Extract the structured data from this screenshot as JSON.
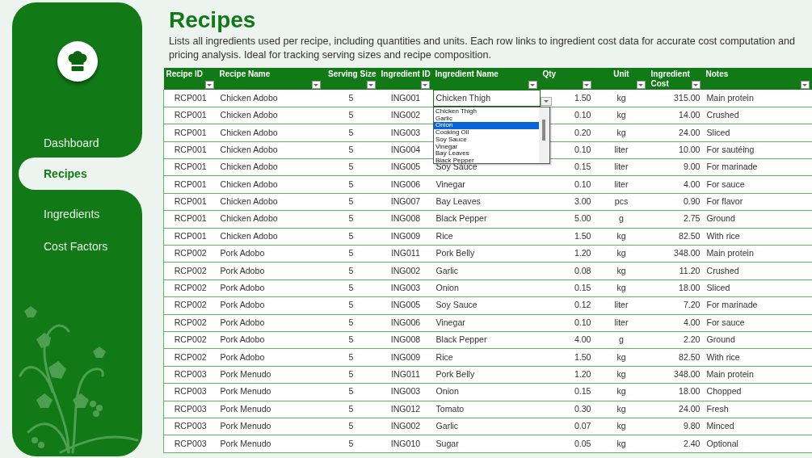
{
  "sidebar": {
    "items": [
      {
        "label": "Dashboard",
        "selected": false
      },
      {
        "label": "Recipes",
        "selected": true
      },
      {
        "label": "Ingredients",
        "selected": false
      },
      {
        "label": "Cost Factors",
        "selected": false
      }
    ]
  },
  "page": {
    "title": "Recipes",
    "description": "Lists all ingredients used per recipe, including quantities and units. Each row links to ingredient cost data for accurate cost computation and pricing analysis. Ideal for tracking serving sizes and recipe composition."
  },
  "table": {
    "columns": [
      {
        "label": "Recipe ID"
      },
      {
        "label": "Recipe Name"
      },
      {
        "label": "Serving Size"
      },
      {
        "label": "Ingredient ID"
      },
      {
        "label": "Ingredient Name"
      },
      {
        "label": "Qty"
      },
      {
        "label": "Unit"
      },
      {
        "label": "Ingredient Cost"
      },
      {
        "label": "Notes"
      }
    ],
    "rows": [
      [
        "RCP001",
        "Chicken Adobo",
        "5",
        "ING001",
        "Chicken Thigh",
        "1.50",
        "kg",
        "315.00",
        "Main protein"
      ],
      [
        "RCP001",
        "Chicken Adobo",
        "5",
        "ING002",
        "",
        "0.10",
        "kg",
        "14.00",
        "Crushed"
      ],
      [
        "RCP001",
        "Chicken Adobo",
        "5",
        "ING003",
        "",
        "0.20",
        "kg",
        "24.00",
        "Sliced"
      ],
      [
        "RCP001",
        "Chicken Adobo",
        "5",
        "ING004",
        "",
        "0.10",
        "liter",
        "10.00",
        "For sautéing"
      ],
      [
        "RCP001",
        "Chicken Adobo",
        "5",
        "ING005",
        "Soy Sauce",
        "0.15",
        "liter",
        "9.00",
        "For marinade"
      ],
      [
        "RCP001",
        "Chicken Adobo",
        "5",
        "ING006",
        "Vinegar",
        "0.10",
        "liter",
        "4.00",
        "For sauce"
      ],
      [
        "RCP001",
        "Chicken Adobo",
        "5",
        "ING007",
        "Bay Leaves",
        "3.00",
        "pcs",
        "0.90",
        "For flavor"
      ],
      [
        "RCP001",
        "Chicken Adobo",
        "5",
        "ING008",
        "Black Pepper",
        "5.00",
        "g",
        "2.75",
        "Ground"
      ],
      [
        "RCP001",
        "Chicken Adobo",
        "5",
        "ING009",
        "Rice",
        "1.50",
        "kg",
        "82.50",
        "With rice"
      ],
      [
        "RCP002",
        "Pork Adobo",
        "5",
        "ING011",
        "Pork Belly",
        "1.20",
        "kg",
        "348.00",
        "Main protein"
      ],
      [
        "RCP002",
        "Pork Adobo",
        "5",
        "ING002",
        "Garlic",
        "0.08",
        "kg",
        "11.20",
        "Crushed"
      ],
      [
        "RCP002",
        "Pork Adobo",
        "5",
        "ING003",
        "Onion",
        "0.15",
        "kg",
        "18.00",
        "Sliced"
      ],
      [
        "RCP002",
        "Pork Adobo",
        "5",
        "ING005",
        "Soy Sauce",
        "0.12",
        "liter",
        "7.20",
        "For marinade"
      ],
      [
        "RCP002",
        "Pork Adobo",
        "5",
        "ING006",
        "Vinegar",
        "0.10",
        "liter",
        "4.00",
        "For sauce"
      ],
      [
        "RCP002",
        "Pork Adobo",
        "5",
        "ING008",
        "Black Pepper",
        "4.00",
        "g",
        "2.20",
        "Ground"
      ],
      [
        "RCP002",
        "Pork Adobo",
        "5",
        "ING009",
        "Rice",
        "1.50",
        "kg",
        "82.50",
        "With rice"
      ],
      [
        "RCP003",
        "Pork Menudo",
        "5",
        "ING011",
        "Pork Belly",
        "1.20",
        "kg",
        "348.00",
        "Main protein"
      ],
      [
        "RCP003",
        "Pork Menudo",
        "5",
        "ING003",
        "Onion",
        "0.15",
        "kg",
        "18.00",
        "Chopped"
      ],
      [
        "RCP003",
        "Pork Menudo",
        "5",
        "ING012",
        "Tomato",
        "0.30",
        "kg",
        "24.00",
        "Fresh"
      ],
      [
        "RCP003",
        "Pork Menudo",
        "5",
        "ING002",
        "Garlic",
        "0.07",
        "kg",
        "9.80",
        "Minced"
      ],
      [
        "RCP003",
        "Pork Menudo",
        "5",
        "ING010",
        "Sugar",
        "0.05",
        "kg",
        "2.40",
        "Optional"
      ]
    ]
  },
  "dropdown": {
    "items": [
      {
        "label": "Chicken Thigh",
        "selected": false
      },
      {
        "label": "Garlic",
        "selected": false
      },
      {
        "label": "Onion",
        "selected": true
      },
      {
        "label": "Cooking Oil",
        "selected": false
      },
      {
        "label": "Soy Sauce",
        "selected": false
      },
      {
        "label": "Vinegar",
        "selected": false
      },
      {
        "label": "Bay Leaves",
        "selected": false
      },
      {
        "label": "Black Pepper",
        "selected": false
      }
    ]
  }
}
